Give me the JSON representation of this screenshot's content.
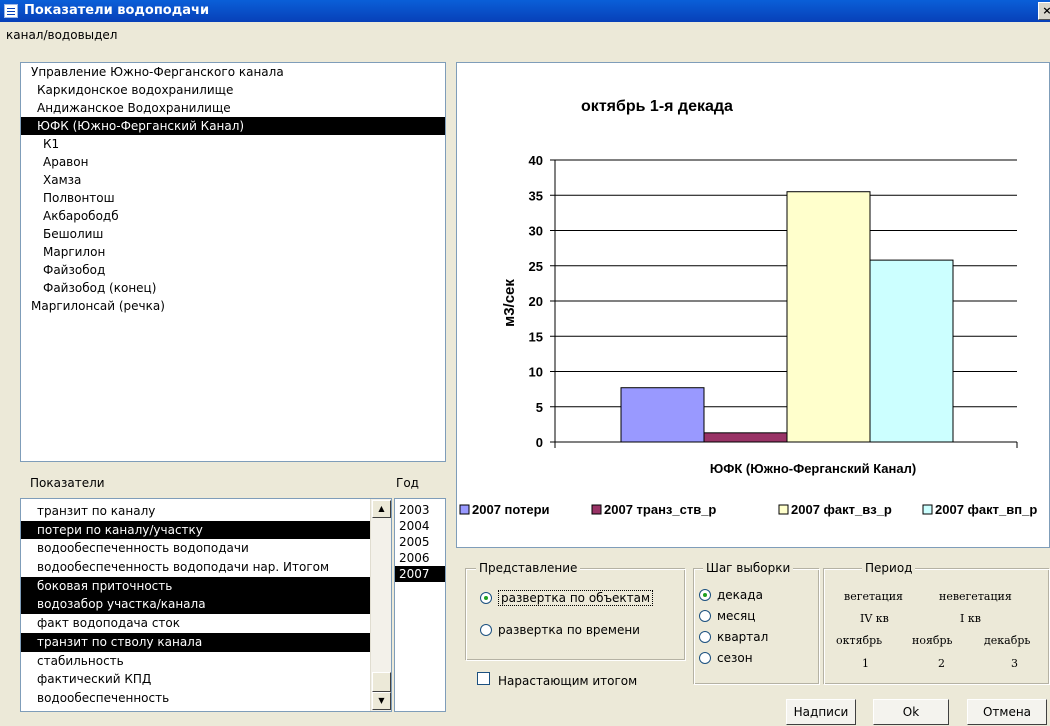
{
  "window": {
    "title": "Показатели водоподачи",
    "close_glyph": "×"
  },
  "objects_label": "канал/водовыдел",
  "objects": [
    {
      "label": "Управление Южно-Ферганского канала",
      "level": 0,
      "selected": false
    },
    {
      "label": "Каркидонское водохранилище",
      "level": 1,
      "selected": false
    },
    {
      "label": "Андижанское Водохранилище",
      "level": 1,
      "selected": false
    },
    {
      "label": "ЮФК (Южно-Ферганский Канал)",
      "level": 1,
      "selected": true
    },
    {
      "label": "К1",
      "level": 2,
      "selected": false
    },
    {
      "label": "Аравон",
      "level": 2,
      "selected": false
    },
    {
      "label": "Хамза",
      "level": 2,
      "selected": false
    },
    {
      "label": "Полвонтош",
      "level": 2,
      "selected": false
    },
    {
      "label": "Акбарободб",
      "level": 2,
      "selected": false
    },
    {
      "label": "Бешолиш",
      "level": 2,
      "selected": false
    },
    {
      "label": "Маргилон",
      "level": 2,
      "selected": false
    },
    {
      "label": "Файзобод",
      "level": 2,
      "selected": false
    },
    {
      "label": "Файзобод (конец)",
      "level": 2,
      "selected": false
    },
    {
      "label": "Маргилонсай (речка)",
      "level": 0,
      "selected": false
    }
  ],
  "indicators_label": "Показатели",
  "indicators": [
    {
      "label": "транзит по каналу",
      "selected": false
    },
    {
      "label": "потери по каналу/участку",
      "selected": true
    },
    {
      "label": "водообеспеченность водоподачи",
      "selected": false
    },
    {
      "label": "водообеспеченность водоподачи нар. Итогом",
      "selected": false
    },
    {
      "label": "боковая приточность",
      "selected": true
    },
    {
      "label": "водозабор участка/канала",
      "selected": true
    },
    {
      "label": "факт водоподача сток",
      "selected": false
    },
    {
      "label": "транзит по стволу канала",
      "selected": true
    },
    {
      "label": "стабильность",
      "selected": false
    },
    {
      "label": "фактический КПД",
      "selected": false
    },
    {
      "label": "водообеспеченность",
      "selected": false
    }
  ],
  "scroll": {
    "up_glyph": "▲",
    "down_glyph": "▼"
  },
  "year_label": "Год",
  "years": [
    {
      "label": "2003",
      "selected": false
    },
    {
      "label": "2004",
      "selected": false
    },
    {
      "label": "2005",
      "selected": false
    },
    {
      "label": "2006",
      "selected": false
    },
    {
      "label": "2007",
      "selected": true
    }
  ],
  "chart_data": {
    "type": "bar",
    "title": "октябрь 1-я декада",
    "xlabel": "ЮФК (Южно-Ферганский Канал)",
    "ylabel": "м3/сек",
    "ylim": [
      0,
      40
    ],
    "yticks": [
      0,
      5,
      10,
      15,
      20,
      25,
      30,
      35,
      40
    ],
    "grid": true,
    "legend": "bottom",
    "series": [
      {
        "name": "2007 потери",
        "value": 7.7,
        "color": "#9999ff"
      },
      {
        "name": "2007 транз_ств_р",
        "value": 1.3,
        "color": "#993366"
      },
      {
        "name": "2007 факт_вз_р",
        "value": 35.5,
        "color": "#ffffcc"
      },
      {
        "name": "2007 факт_вп_р",
        "value": 25.8,
        "color": "#ccffff"
      }
    ]
  },
  "view": {
    "title": "Представление",
    "options": [
      {
        "label": "развертка по объектам",
        "checked": true
      },
      {
        "label": "развертка по времени",
        "checked": false
      }
    ]
  },
  "step": {
    "title": "Шаг выборки",
    "options": [
      {
        "label": "декада",
        "checked": true
      },
      {
        "label": "месяц",
        "checked": false
      },
      {
        "label": "квартал",
        "checked": false
      },
      {
        "label": "сезон",
        "checked": false
      }
    ]
  },
  "period": {
    "title": "Период",
    "season_veg": "вегетация",
    "season_nonveg": "невегетация",
    "quarter_veg": "IV кв",
    "quarter_nonveg": "I кв",
    "months": [
      "октябрь",
      "ноябрь",
      "декабрь"
    ],
    "numbers": [
      "1",
      "2",
      "3"
    ]
  },
  "cumulative_label": "Нарастающим итогом",
  "buttons": {
    "captions": "Надписи",
    "ok": "Ok",
    "cancel": "Отмена"
  }
}
